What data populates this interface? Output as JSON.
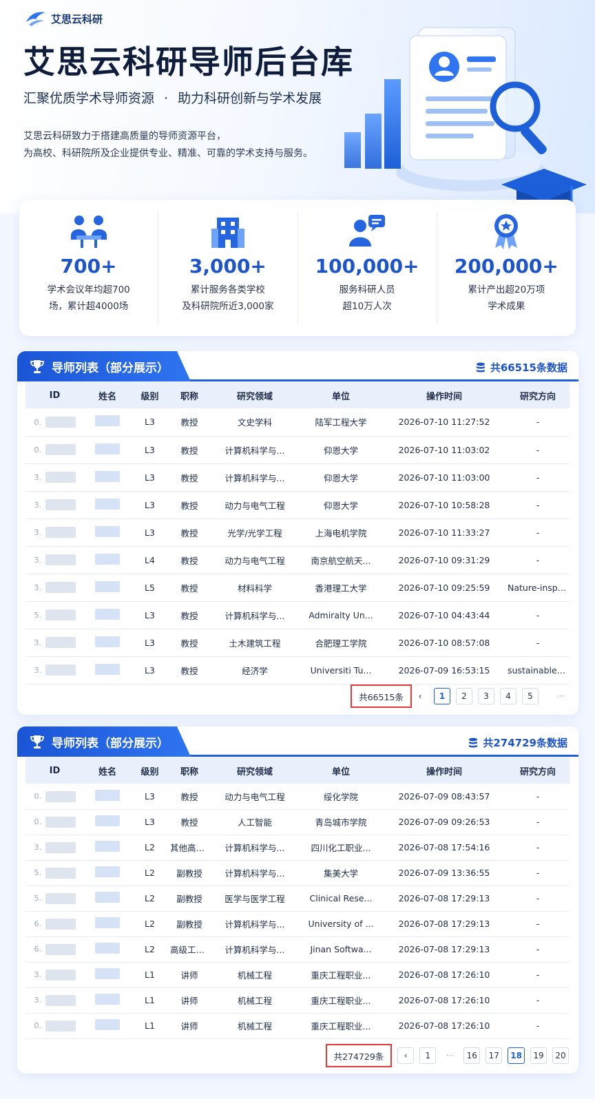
{
  "brand": {
    "name": "艾思云科研"
  },
  "hero": {
    "title": "艾思云科研导师后台库",
    "subtitle_left": "汇聚优质学术导师资源",
    "subtitle_sep": "·",
    "subtitle_right": "助力科研创新与学术发展",
    "desc_line1": "艾思云科研致力于搭建高质量的导师资源平台，",
    "desc_line2": "为高校、科研院所及企业提供专业、精准、可靠的学术支持与服务。"
  },
  "stats": [
    {
      "icon": "meeting-icon",
      "value": "700+",
      "desc": "学术会议年均超700\n场，累计超4000场"
    },
    {
      "icon": "building-icon",
      "value": "3,000+",
      "desc": "累计服务各类学校\n及科研院所近3,000家"
    },
    {
      "icon": "researcher-icon",
      "value": "100,000+",
      "desc": "服务科研人员\n超10万人次"
    },
    {
      "icon": "award-icon",
      "value": "200,000+",
      "desc": "累计产出超20万项\n学术成果"
    }
  ],
  "columns": [
    "ID",
    "姓名",
    "级别",
    "职称",
    "研究领域",
    "单位",
    "操作时间",
    "研究方向"
  ],
  "panel1": {
    "tab_label": "导师列表（部分展示）",
    "total_label": "共66515条数据",
    "rows": [
      {
        "id_prefix": "0.",
        "level": "L3",
        "title": "教授",
        "field": "文史学科",
        "unit": "陆军工程大学",
        "time": "2026-07-10 11:27:52",
        "direction": "-"
      },
      {
        "id_prefix": "0.",
        "level": "L3",
        "title": "教授",
        "field": "计算机科学与...",
        "unit": "仰恩大学",
        "time": "2026-07-10 11:03:02",
        "direction": "-"
      },
      {
        "id_prefix": "3.",
        "level": "L3",
        "title": "教授",
        "field": "计算机科学与...",
        "unit": "仰恩大学",
        "time": "2026-07-10 11:03:00",
        "direction": "-"
      },
      {
        "id_prefix": "3.",
        "level": "L3",
        "title": "教授",
        "field": "动力与电气工程",
        "unit": "仰恩大学",
        "time": "2026-07-10 10:58:28",
        "direction": "-"
      },
      {
        "id_prefix": "3.",
        "level": "L3",
        "title": "教授",
        "field": "光学/光学工程",
        "unit": "上海电机学院",
        "time": "2026-07-10 11:33:27",
        "direction": "-"
      },
      {
        "id_prefix": "3.",
        "level": "L4",
        "title": "教授",
        "field": "动力与电气工程",
        "unit": "南京航空航天...",
        "time": "2026-07-10 09:31:29",
        "direction": "-"
      },
      {
        "id_prefix": "3.",
        "level": "L5",
        "title": "教授",
        "field": "材料科学",
        "unit": "香港理工大学",
        "time": "2026-07-10 09:25:59",
        "direction": "Nature-inspi..."
      },
      {
        "id_prefix": "5.",
        "level": "L3",
        "title": "教授",
        "field": "计算机科学与...",
        "unit": "Admiralty Un...",
        "time": "2026-07-10 04:43:44",
        "direction": "-"
      },
      {
        "id_prefix": "3.",
        "level": "L3",
        "title": "教授",
        "field": "土木建筑工程",
        "unit": "合肥理工学院",
        "time": "2026-07-10 08:57:08",
        "direction": "-"
      },
      {
        "id_prefix": "3.",
        "level": "L3",
        "title": "教授",
        "field": "经济学",
        "unit": "Universiti Tu...",
        "time": "2026-07-09 16:53:15",
        "direction": "sustainable fi..."
      }
    ],
    "pagination": {
      "total": "共66515条",
      "prev": "‹",
      "pages": [
        "1",
        "2",
        "3",
        "4",
        "5"
      ],
      "active": "1",
      "more": "···"
    }
  },
  "panel2": {
    "tab_label": "导师列表（部分展示）",
    "total_label": "共274729条数据",
    "rows": [
      {
        "id_prefix": "0.",
        "level": "L3",
        "title": "教授",
        "field": "动力与电气工程",
        "unit": "绥化学院",
        "time": "2026-07-09 08:43:57",
        "direction": "-"
      },
      {
        "id_prefix": "0.",
        "level": "L3",
        "title": "教授",
        "field": "人工智能",
        "unit": "青岛城市学院",
        "time": "2026-07-09 09:26:53",
        "direction": "-"
      },
      {
        "id_prefix": "3.",
        "level": "L2",
        "title": "其他高级职称",
        "field": "计算机科学与...",
        "unit": "四川化工职业...",
        "time": "2026-07-08 17:54:16",
        "direction": "-"
      },
      {
        "id_prefix": "5.",
        "level": "L2",
        "title": "副教授",
        "field": "计算机科学与...",
        "unit": "集美大学",
        "time": "2026-07-09 13:36:55",
        "direction": "-"
      },
      {
        "id_prefix": "5.",
        "level": "L2",
        "title": "副教授",
        "field": "医学与医学工程",
        "unit": "Clinical Rese...",
        "time": "2026-07-08 17:29:13",
        "direction": "-"
      },
      {
        "id_prefix": "6.",
        "level": "L2",
        "title": "副教授",
        "field": "计算机科学与...",
        "unit": "University of ...",
        "time": "2026-07-08 17:29:13",
        "direction": "-"
      },
      {
        "id_prefix": "6.",
        "level": "L2",
        "title": "高级工程师",
        "field": "计算机科学与...",
        "unit": "Jinan Softwa...",
        "time": "2026-07-08 17:29:13",
        "direction": "-"
      },
      {
        "id_prefix": "3.",
        "level": "L1",
        "title": "讲师",
        "field": "机械工程",
        "unit": "重庆工程职业...",
        "time": "2026-07-08 17:26:10",
        "direction": "-"
      },
      {
        "id_prefix": "3.",
        "level": "L1",
        "title": "讲师",
        "field": "机械工程",
        "unit": "重庆工程职业...",
        "time": "2026-07-08 17:26:10",
        "direction": "-"
      },
      {
        "id_prefix": "0.",
        "level": "L1",
        "title": "讲师",
        "field": "机械工程",
        "unit": "重庆工程职业...",
        "time": "2026-07-08 17:26:10",
        "direction": "-"
      }
    ],
    "pagination": {
      "total": "共274729条",
      "prev": "‹",
      "first": "1",
      "more": "···",
      "pages": [
        "16",
        "17",
        "18",
        "19",
        "20"
      ],
      "active": "18"
    }
  },
  "colors": {
    "primary": "#1d54c9",
    "accent": "#2f74f0",
    "highlight": "#e23a3a"
  }
}
